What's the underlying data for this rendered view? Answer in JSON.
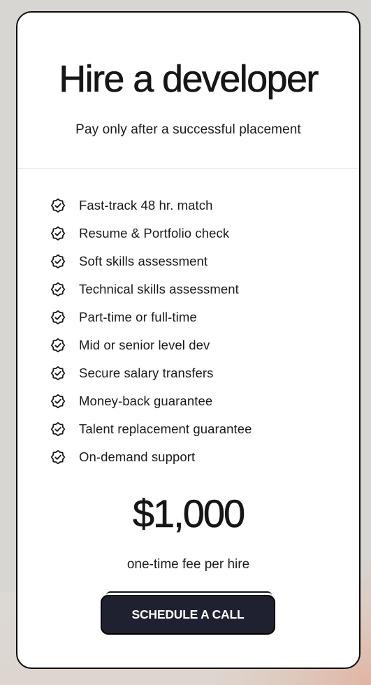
{
  "pricing_card": {
    "title": "Hire a developer",
    "subtitle": "Pay only after a successful placement",
    "features": [
      {
        "icon": "badge-check-icon",
        "label": "Fast-track 48 hr. match"
      },
      {
        "icon": "badge-check-icon",
        "label": "Resume & Portfolio check"
      },
      {
        "icon": "badge-check-icon",
        "label": "Soft skills assessment"
      },
      {
        "icon": "badge-check-icon",
        "label": "Technical skills assessment"
      },
      {
        "icon": "badge-check-icon",
        "label": "Part-time or full-time"
      },
      {
        "icon": "badge-check-icon",
        "label": "Mid or senior level dev"
      },
      {
        "icon": "badge-check-icon",
        "label": "Secure salary transfers"
      },
      {
        "icon": "badge-check-icon",
        "label": "Money-back guarantee"
      },
      {
        "icon": "badge-check-icon",
        "label": "Talent replacement guarantee"
      },
      {
        "icon": "badge-check-icon",
        "label": "On-demand support"
      }
    ],
    "price": "$1,000",
    "price_note": "one-time fee per hire",
    "cta_label": "SCHEDULE A CALL"
  },
  "colors": {
    "background": "#d8d6d3",
    "card": "#ffffff",
    "text": "#161616",
    "button": "#1f2130",
    "button_text": "#ffffff",
    "divider": "#e2e2e2"
  }
}
